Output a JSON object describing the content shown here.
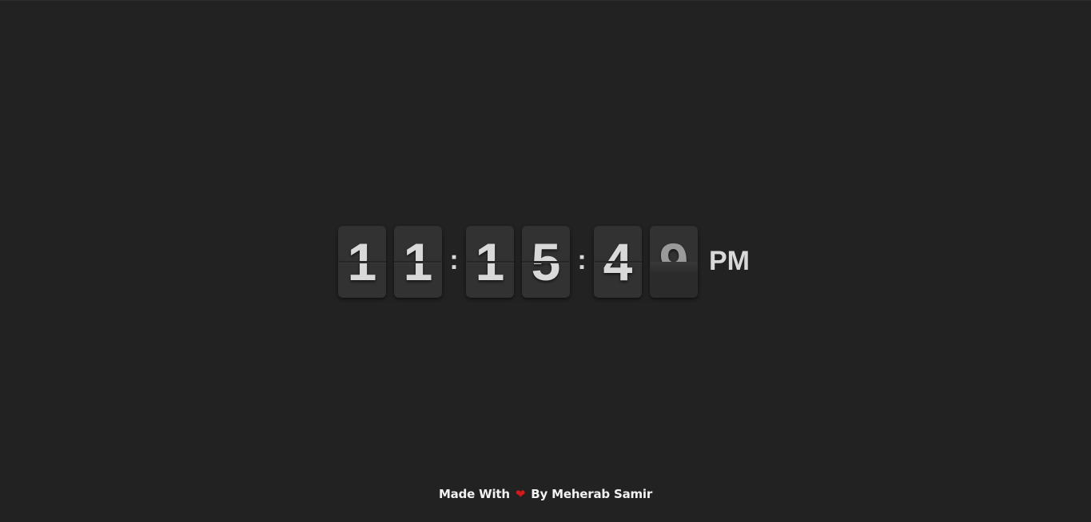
{
  "clock": {
    "hours": [
      "1",
      "1"
    ],
    "minutes": [
      "1",
      "5"
    ],
    "seconds": [
      "4",
      "9"
    ],
    "separator": ":",
    "period": "PM"
  },
  "footer": {
    "made_with": "Made With",
    "heart_icon": "heart-icon",
    "by": "By Meherab Samir"
  },
  "colors": {
    "background": "#222222",
    "card": "#323232",
    "digit": "#d9d9d9",
    "heart": "#d11a1a"
  }
}
